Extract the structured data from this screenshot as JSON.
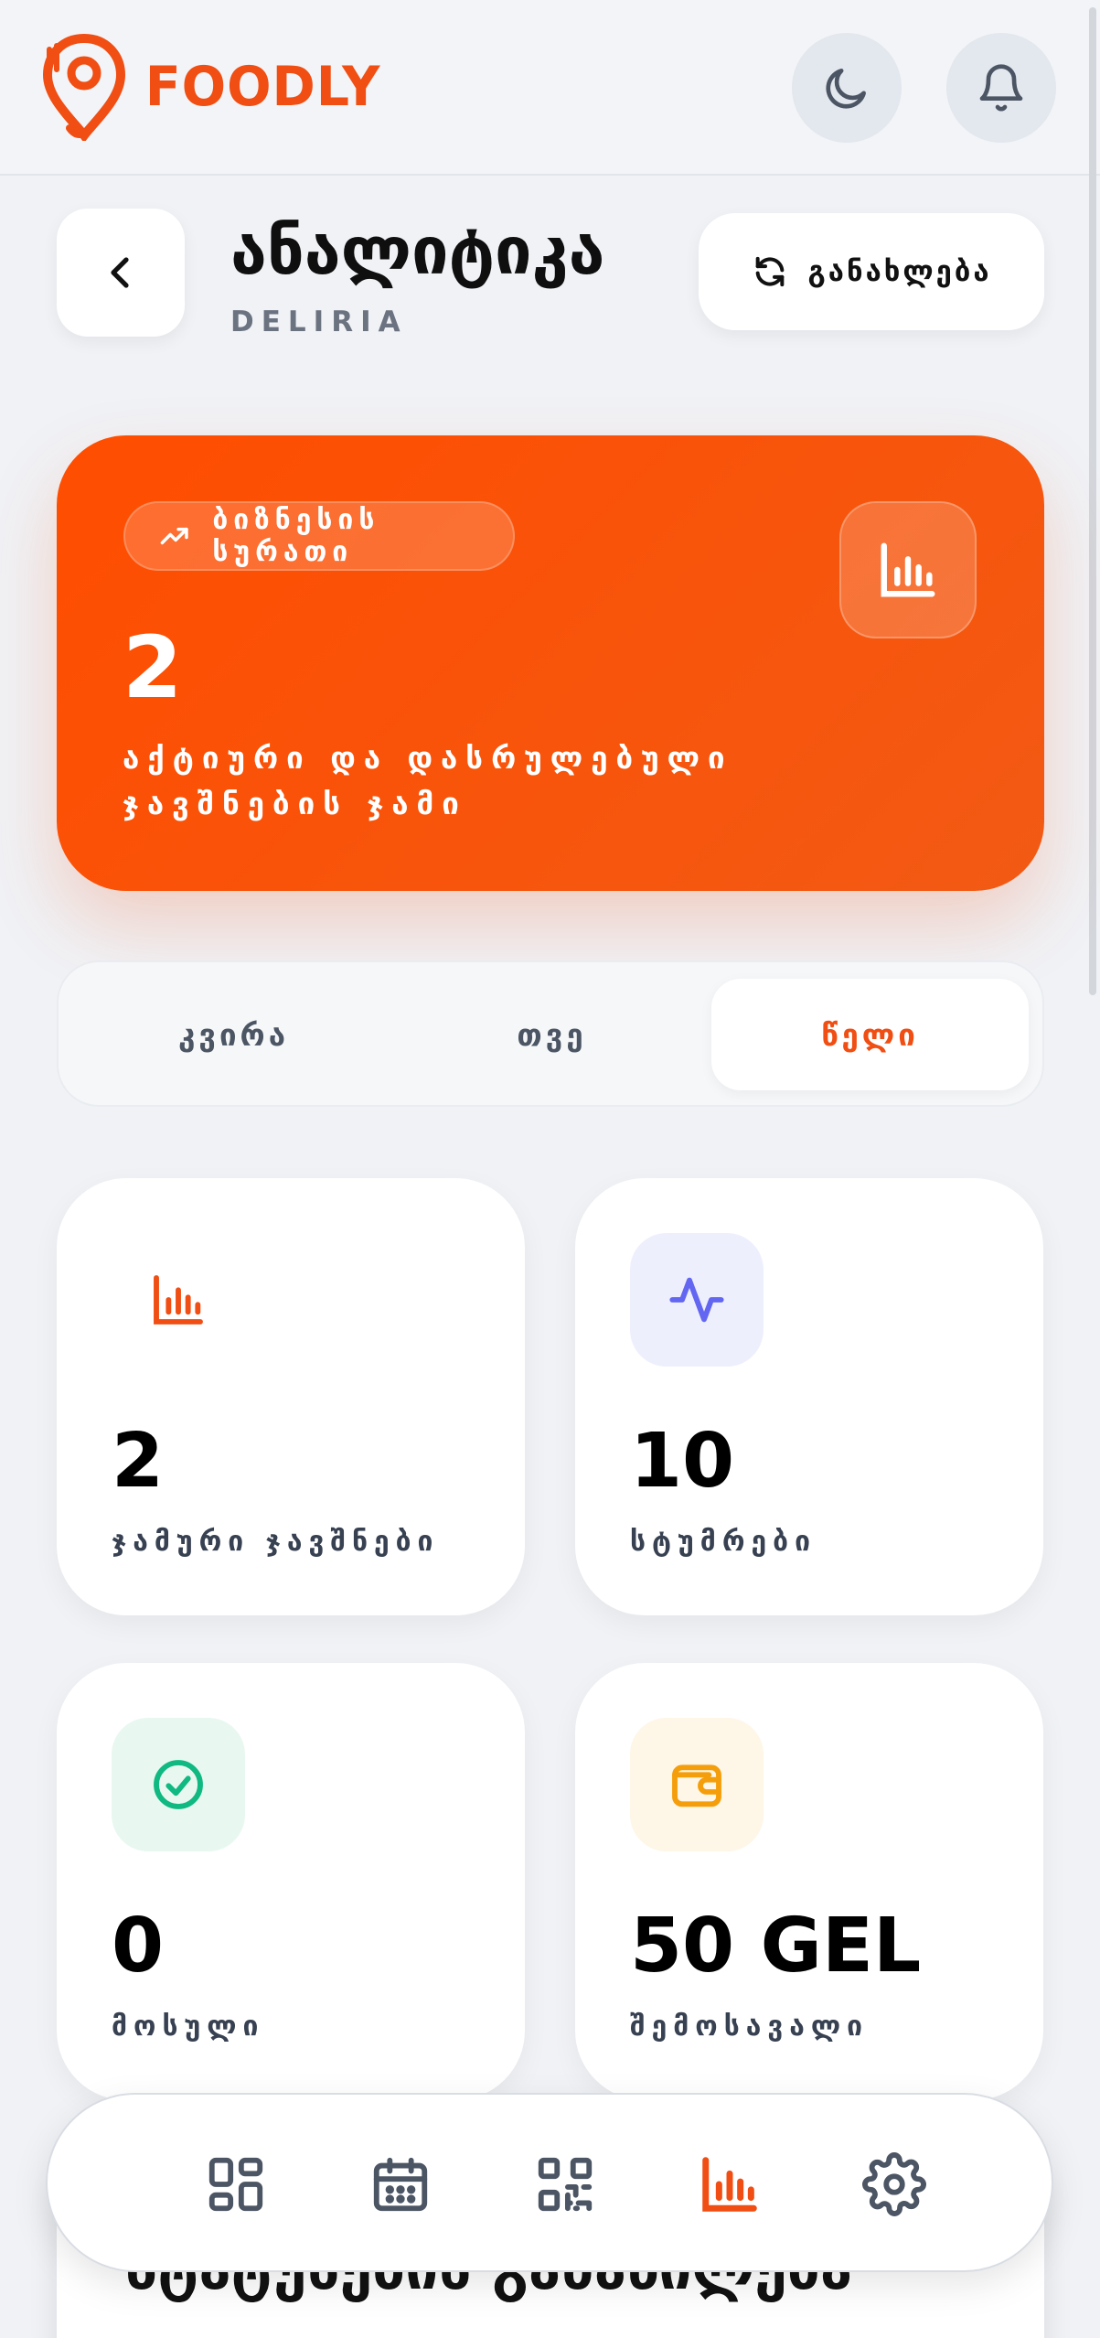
{
  "header": {
    "brand": "FOODLY",
    "brand_color": "#F04E13"
  },
  "page": {
    "title": "ანალიტიკა",
    "subtitle": "DELIRIA",
    "refresh_label": "განახლება"
  },
  "hero": {
    "pill_label": "ბიზნესის სურათი",
    "value": "2",
    "description": "აქტიური და დასრულებული ჯავშნების ჯამი"
  },
  "tabs": [
    {
      "label": "კვირა",
      "active": false
    },
    {
      "label": "თვე",
      "active": false
    },
    {
      "label": "წელი",
      "active": true
    }
  ],
  "stats": [
    {
      "value": "2",
      "label": "ჯამური ჯავშნები",
      "icon": "bar-chart-icon"
    },
    {
      "value": "10",
      "label": "სტუმრები",
      "icon": "activity-icon"
    },
    {
      "value": "0",
      "label": "მოსული",
      "icon": "check-circle-icon"
    },
    {
      "value": "50 GEL",
      "label": "შემოსავალი",
      "icon": "wallet-icon"
    }
  ],
  "section": {
    "title": "სტატუსების განაწილება"
  },
  "nav": [
    "dashboard-icon",
    "calendar-icon",
    "qr-code-icon",
    "analytics-icon",
    "settings-icon"
  ],
  "colors": {
    "accent": "#F04E13",
    "purple": "#6366F1",
    "green": "#10B981",
    "amber": "#F59E0B"
  }
}
